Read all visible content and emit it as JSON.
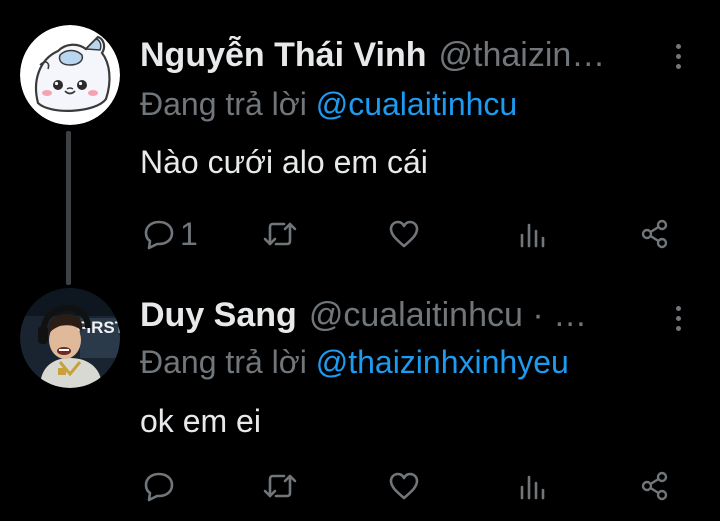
{
  "thread": [
    {
      "display_name": "Nguyễn Thái Vinh",
      "handle": "@thaizin…",
      "reply_prefix": "Đang trả lời ",
      "reply_to": "@cualaitinhcu",
      "text": "Nào cưới alo em cái",
      "reply_count": "1",
      "retweet_count": "",
      "like_count": ""
    },
    {
      "display_name": "Duy Sang",
      "handle": "@cualaitinhcu · …",
      "reply_prefix": "Đang trả lời ",
      "reply_to": "@thaizinhxinhyeu",
      "text": "ok em ei",
      "reply_count": "",
      "retweet_count": "",
      "like_count": "",
      "avatar_caption": "FIRST"
    }
  ],
  "icons": {
    "reply": "comment-icon",
    "retweet": "retweet-icon",
    "like": "heart-icon",
    "views": "analytics-icon",
    "share": "share-icon",
    "more": "more-vertical-icon"
  },
  "colors": {
    "background": "#000000",
    "primary_text": "#e7e9ea",
    "secondary_text": "#71767b",
    "link": "#1d9bf0",
    "thread_line": "#3e4144"
  }
}
